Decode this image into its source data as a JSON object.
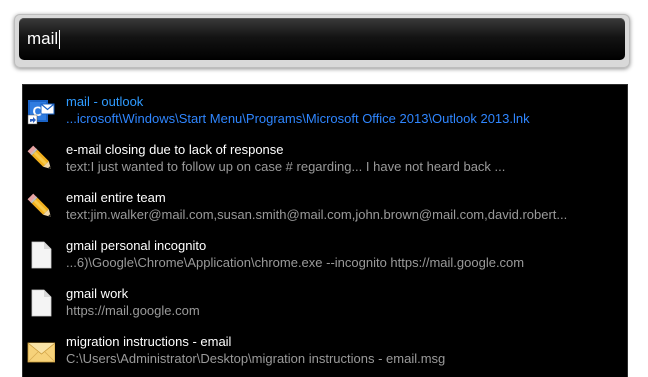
{
  "search": {
    "query": "mail"
  },
  "results": [
    {
      "title": "mail - outlook",
      "subtitle": "...icrosoft\\Windows\\Start Menu\\Programs\\Microsoft Office 2013\\Outlook 2013.lnk",
      "icon": "outlook-icon",
      "selected": true
    },
    {
      "title": "e-mail closing due to lack of response",
      "subtitle": "text:I just wanted to follow up on case # regarding...  I have not heard back ...",
      "icon": "pencil-icon"
    },
    {
      "title": "email entire team",
      "subtitle": "text:jim.walker@mail.com,susan.smith@mail.com,john.brown@mail.com,david.robert...",
      "icon": "pencil-icon"
    },
    {
      "title": "gmail personal incognito",
      "subtitle": "...6)\\Google\\Chrome\\Application\\chrome.exe --incognito https://mail.google.com",
      "icon": "document-icon"
    },
    {
      "title": "gmail work",
      "subtitle": "https://mail.google.com",
      "icon": "document-icon"
    },
    {
      "title": "migration instructions - email",
      "subtitle": "C:\\Users\\Administrator\\Desktop\\migration instructions - email.msg",
      "icon": "envelope-icon"
    }
  ],
  "colors": {
    "selected_title": "#2f9bff",
    "background": "#000000"
  }
}
